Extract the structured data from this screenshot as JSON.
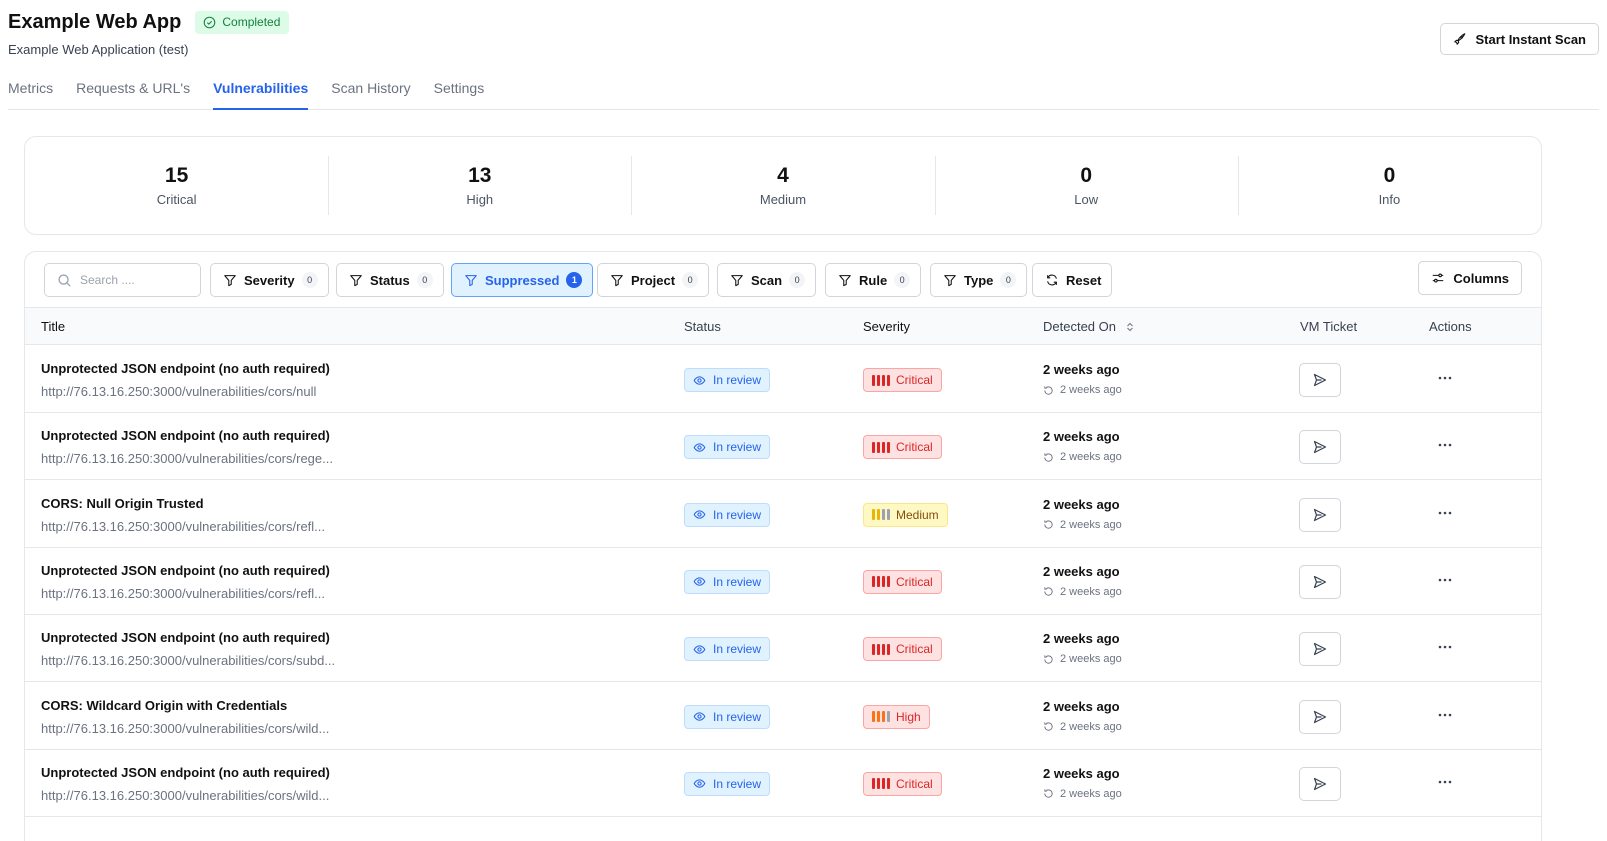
{
  "header": {
    "title": "Example Web App",
    "status": "Completed",
    "subtitle": "Example Web Application (test)",
    "scan_button": "Start Instant Scan"
  },
  "tabs": [
    {
      "label": "Metrics",
      "active": false
    },
    {
      "label": "Requests & URL's",
      "active": false
    },
    {
      "label": "Vulnerabilities",
      "active": true
    },
    {
      "label": "Scan History",
      "active": false
    },
    {
      "label": "Settings",
      "active": false
    }
  ],
  "stats": [
    {
      "value": "15",
      "label": "Critical"
    },
    {
      "value": "13",
      "label": "High"
    },
    {
      "value": "4",
      "label": "Medium"
    },
    {
      "value": "0",
      "label": "Low"
    },
    {
      "value": "0",
      "label": "Info"
    }
  ],
  "toolbar": {
    "search_placeholder": "Search ....",
    "filters": [
      {
        "label": "Severity",
        "count": "0"
      },
      {
        "label": "Status",
        "count": "0"
      },
      {
        "label": "Suppressed",
        "count": "1"
      },
      {
        "label": "Project",
        "count": "0"
      },
      {
        "label": "Scan",
        "count": "0"
      },
      {
        "label": "Rule",
        "count": "0"
      },
      {
        "label": "Type",
        "count": "0"
      }
    ],
    "reset_label": "Reset",
    "columns_label": "Columns"
  },
  "table": {
    "headers": {
      "title": "Title",
      "status": "Status",
      "severity": "Severity",
      "detected": "Detected On",
      "ticket": "VM Ticket",
      "actions": "Actions"
    },
    "rows": [
      {
        "title": "Unprotected JSON endpoint (no auth required)",
        "url": "http://76.13.16.250:3000/vulnerabilities/cors/null",
        "status": "In review",
        "severity": "Critical",
        "detected": "2 weeks ago",
        "detected_sub": "2 weeks ago"
      },
      {
        "title": "Unprotected JSON endpoint (no auth required)",
        "url": "http://76.13.16.250:3000/vulnerabilities/cors/rege...",
        "status": "In review",
        "severity": "Critical",
        "detected": "2 weeks ago",
        "detected_sub": "2 weeks ago"
      },
      {
        "title": "CORS: Null Origin Trusted",
        "url": "http://76.13.16.250:3000/vulnerabilities/cors/refl...",
        "status": "In review",
        "severity": "Medium",
        "detected": "2 weeks ago",
        "detected_sub": "2 weeks ago"
      },
      {
        "title": "Unprotected JSON endpoint (no auth required)",
        "url": "http://76.13.16.250:3000/vulnerabilities/cors/refl...",
        "status": "In review",
        "severity": "Critical",
        "detected": "2 weeks ago",
        "detected_sub": "2 weeks ago"
      },
      {
        "title": "Unprotected JSON endpoint (no auth required)",
        "url": "http://76.13.16.250:3000/vulnerabilities/cors/subd...",
        "status": "In review",
        "severity": "Critical",
        "detected": "2 weeks ago",
        "detected_sub": "2 weeks ago"
      },
      {
        "title": "CORS: Wildcard Origin with Credentials",
        "url": "http://76.13.16.250:3000/vulnerabilities/cors/wild...",
        "status": "In review",
        "severity": "High",
        "detected": "2 weeks ago",
        "detected_sub": "2 weeks ago"
      },
      {
        "title": "Unprotected JSON endpoint (no auth required)",
        "url": "http://76.13.16.250:3000/vulnerabilities/cors/wild...",
        "status": "In review",
        "severity": "Critical",
        "detected": "2 weeks ago",
        "detected_sub": "2 weeks ago"
      }
    ]
  },
  "colors": {
    "accent": "#2563eb",
    "critical": "#dc2626",
    "high": "#f97316",
    "medium": "#ca8a04",
    "completed": "#15803d"
  }
}
